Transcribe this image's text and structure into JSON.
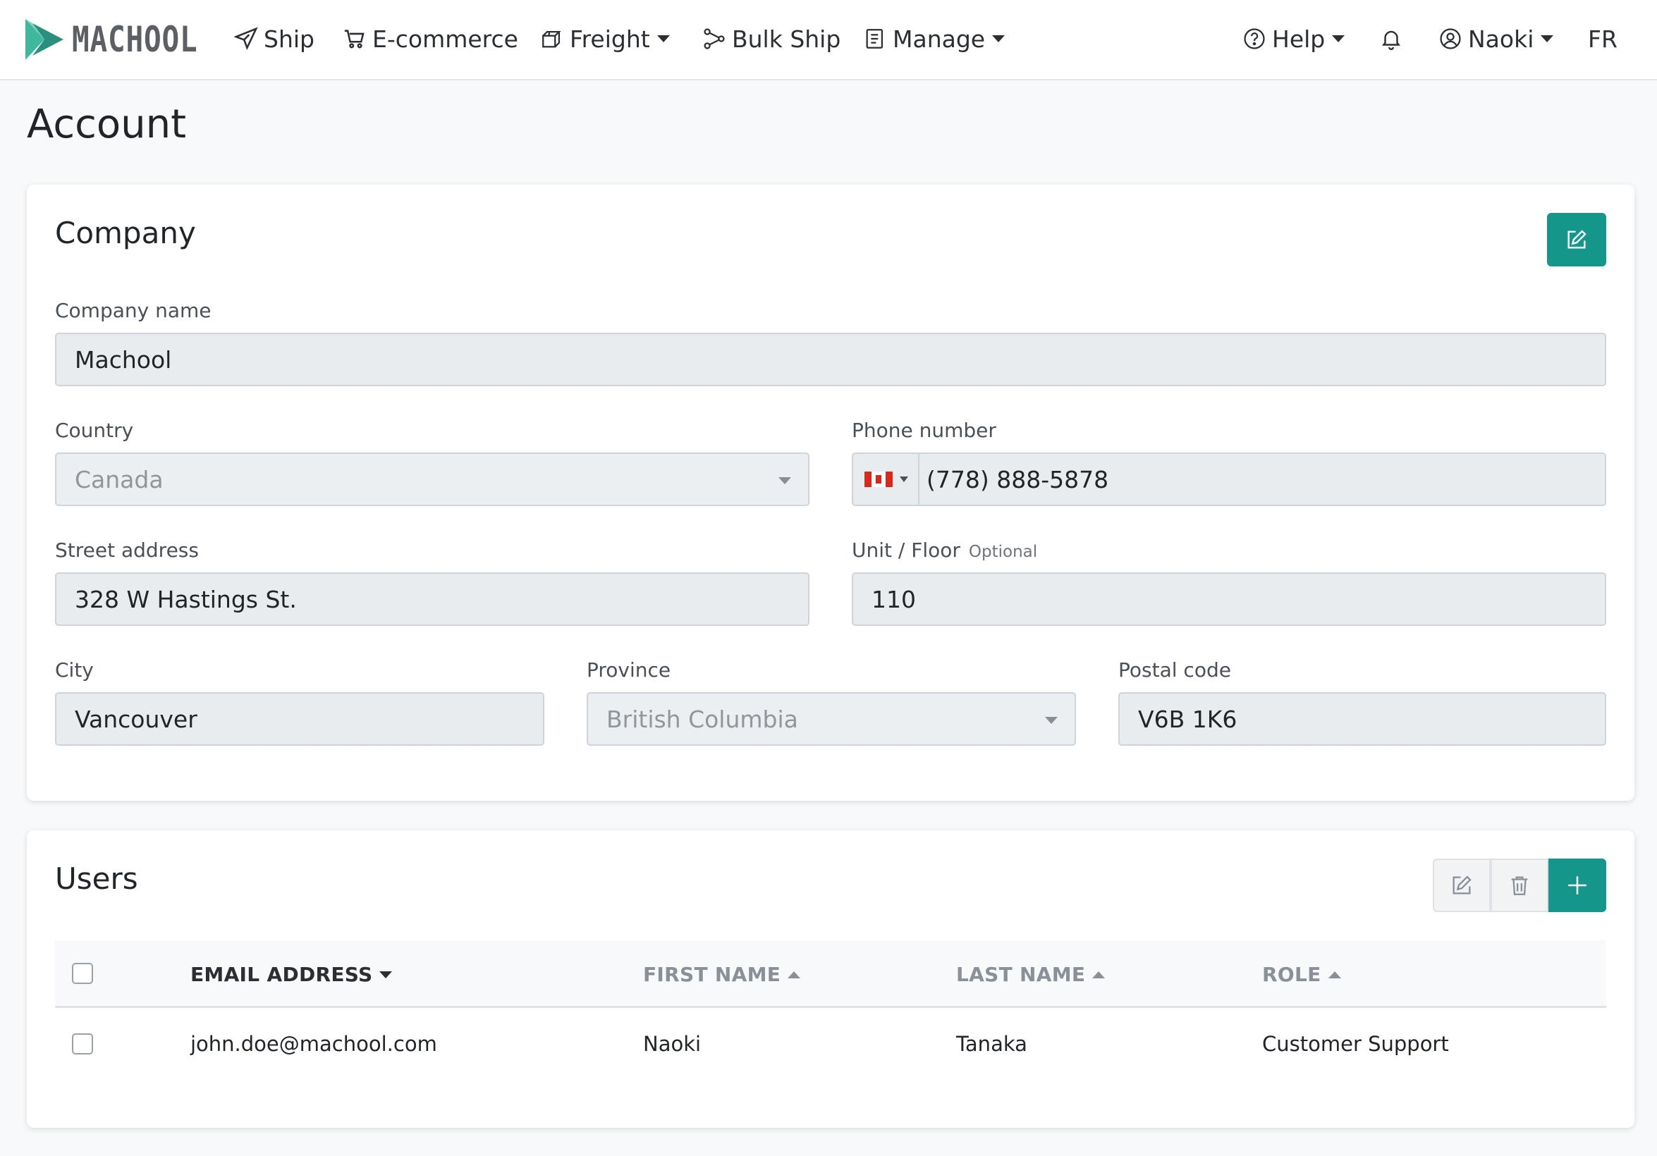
{
  "brand": {
    "name": "MACHOOL"
  },
  "colors": {
    "accent": "#14978a",
    "brand_teal": "#3fb8a0",
    "brand_dark": "#5c6064"
  },
  "nav": {
    "ship": "Ship",
    "ecommerce": "E-commerce",
    "freight": "Freight",
    "bulk_ship": "Bulk Ship",
    "manage": "Manage",
    "help": "Help",
    "user": "Naoki",
    "lang": "FR"
  },
  "page": {
    "title": "Account"
  },
  "company": {
    "title": "Company",
    "company_name_label": "Company name",
    "company_name": "Machool",
    "country_label": "Country",
    "country": "Canada",
    "phone_label": "Phone number",
    "phone": "(778) 888-5878",
    "street_label": "Street address",
    "street": "328 W Hastings St.",
    "unit_label": "Unit / Floor",
    "unit_optional": "Optional",
    "unit": "110",
    "city_label": "City",
    "city": "Vancouver",
    "province_label": "Province",
    "province": "British Columbia",
    "postal_label": "Postal code",
    "postal": "V6B 1K6"
  },
  "users": {
    "title": "Users",
    "columns": {
      "email": "EMAIL ADDRESS",
      "first": "FIRST NAME",
      "last": "LAST NAME",
      "role": "ROLE"
    },
    "rows": [
      {
        "email": "john.doe@machool.com",
        "first": "Naoki",
        "last": "Tanaka",
        "role": "Customer Support"
      }
    ]
  }
}
